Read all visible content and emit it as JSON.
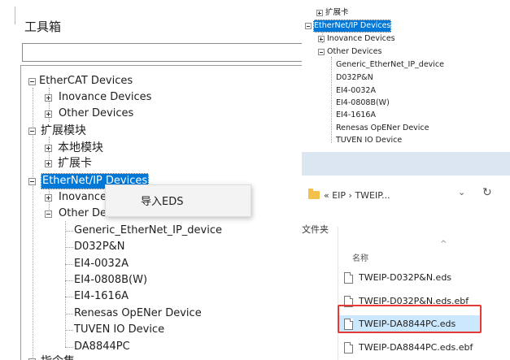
{
  "toolbox": {
    "title": "工具箱",
    "search_value": "",
    "tree": {
      "ethercat": "EtherCAT Devices",
      "inovance": "Inovance Devices",
      "other": "Other Devices",
      "expansion": "扩展模块",
      "local_module": "本地模块",
      "expansion_card": "扩展卡",
      "ethernetip": "EtherNet/IP Devices",
      "eip_inovance": "Inovance Devices",
      "eip_other": "Other Devices",
      "devices": [
        "Generic_EtherNet_IP_device",
        "D032P&N",
        "EI4-0032A",
        "EI4-0808B(W)",
        "EI4-1616A",
        "Renesas OpENer Device",
        "TUVEN IO Device",
        "DA8844PC"
      ],
      "instructions": "指令集"
    },
    "context_menu": {
      "import_eds": "导入EDS"
    }
  },
  "mini_tree": {
    "expansion_card": "扩展卡",
    "ethernetip": "EtherNet/IP Devices",
    "inovance": "Inovance Devices",
    "other": "Other Devices",
    "devices": [
      "Generic_EtherNet_IP_device",
      "D032P&N",
      "EI4-0032A",
      "EI4-0808B(W)",
      "EI4-1616A",
      "Renesas OpENer Device",
      "TUVEN IO Device"
    ]
  },
  "explorer": {
    "breadcrumb": "« EIP › TWEIP...",
    "chevron": "⌄",
    "refresh": "↻",
    "sidebar_label": "文件夹",
    "column_name": "名称",
    "sort_icon": "^",
    "files": [
      "TWEIP-D032P&N.eds",
      "TWEIP-D032P&N.eds.ebf",
      "TWEIP-DA8844PC.eds",
      "TWEIP-DA8844PC.eds.ebf"
    ],
    "highlight_color": "#e53935"
  }
}
